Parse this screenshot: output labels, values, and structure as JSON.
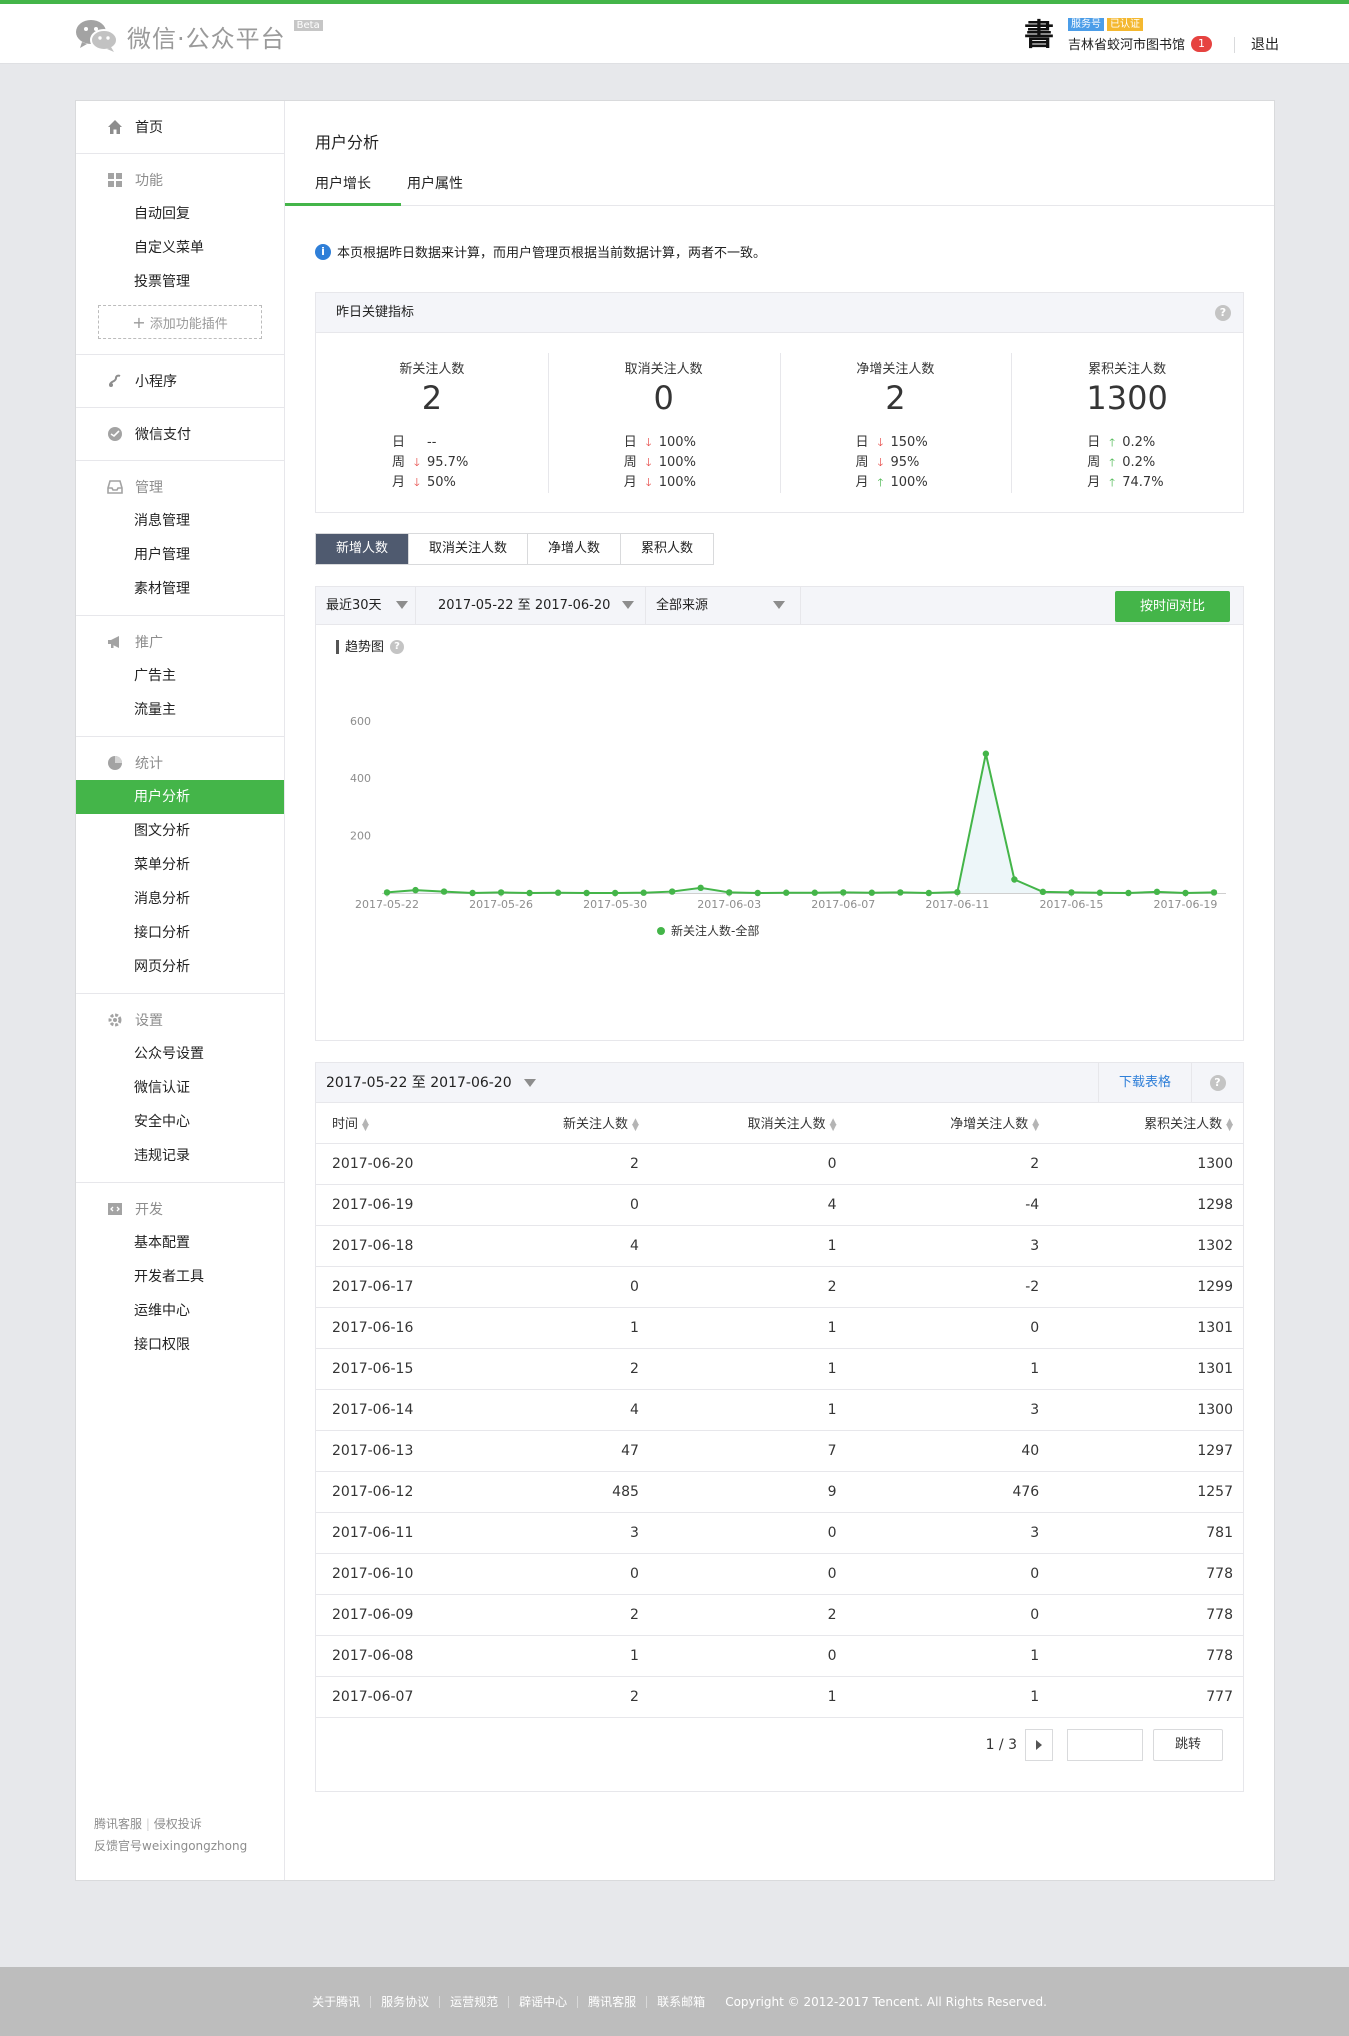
{
  "brand": {
    "name": "微信·公众平台",
    "beta": "Beta"
  },
  "account": {
    "type_badge": "服务号",
    "verified_badge": "已认证",
    "name": "吉林省蛟河市图书馆",
    "msg_count": "1",
    "logout": "退出",
    "avatar_glyph": "書"
  },
  "sidebar": {
    "home": "首页",
    "func_title": "功能",
    "func_items": [
      "自动回复",
      "自定义菜单",
      "投票管理"
    ],
    "add_plugin": "添加功能插件",
    "miniprogram": "小程序",
    "wxpay": "微信支付",
    "manage_title": "管理",
    "manage_items": [
      "消息管理",
      "用户管理",
      "素材管理"
    ],
    "promo_title": "推广",
    "promo_items": [
      "广告主",
      "流量主"
    ],
    "stats_title": "统计",
    "stats_items": [
      "用户分析",
      "图文分析",
      "菜单分析",
      "消息分析",
      "接口分析",
      "网页分析"
    ],
    "settings_title": "设置",
    "settings_items": [
      "公众号设置",
      "微信认证",
      "安全中心",
      "违规记录"
    ],
    "dev_title": "开发",
    "dev_items": [
      "基本配置",
      "开发者工具",
      "运维中心",
      "接口权限"
    ],
    "footer_links": [
      "腾讯客服",
      "侵权投诉"
    ],
    "footer_feedback": "反馈官号weixingongzhong"
  },
  "page": {
    "title": "用户分析",
    "tabs": [
      "用户增长",
      "用户属性"
    ],
    "notice": "本页根据昨日数据来计算，而用户管理页根据当前数据计算，两者不一致。"
  },
  "kpi": {
    "title": "昨日关键指标",
    "row_labels": [
      "日",
      "周",
      "月"
    ],
    "cards": [
      {
        "label": "新关注人数",
        "value": "2",
        "rows": [
          {
            "dir": "none",
            "val": "--"
          },
          {
            "dir": "down",
            "val": "95.7%"
          },
          {
            "dir": "down",
            "val": "50%"
          }
        ]
      },
      {
        "label": "取消关注人数",
        "value": "0",
        "rows": [
          {
            "dir": "down",
            "val": "100%"
          },
          {
            "dir": "down",
            "val": "100%"
          },
          {
            "dir": "down",
            "val": "100%"
          }
        ]
      },
      {
        "label": "净增关注人数",
        "value": "2",
        "rows": [
          {
            "dir": "down",
            "val": "150%"
          },
          {
            "dir": "down",
            "val": "95%"
          },
          {
            "dir": "up",
            "val": "100%"
          }
        ]
      },
      {
        "label": "累积关注人数",
        "value": "1300",
        "rows": [
          {
            "dir": "up",
            "val": "0.2%"
          },
          {
            "dir": "up",
            "val": "0.2%"
          },
          {
            "dir": "up",
            "val": "74.7%"
          }
        ]
      }
    ]
  },
  "metric_tabs": [
    "新增人数",
    "取消关注人数",
    "净增人数",
    "累积人数"
  ],
  "filters": {
    "period": "最近30天",
    "range": "2017-05-22 至 2017-06-20",
    "source": "全部来源",
    "compare_btn": "按时间对比"
  },
  "chart_title": "趋势图",
  "chart_data": {
    "type": "line",
    "title": "趋势图",
    "x": [
      "2017-05-22",
      "2017-05-23",
      "2017-05-24",
      "2017-05-25",
      "2017-05-26",
      "2017-05-27",
      "2017-05-28",
      "2017-05-29",
      "2017-05-30",
      "2017-05-31",
      "2017-06-01",
      "2017-06-02",
      "2017-06-03",
      "2017-06-04",
      "2017-06-05",
      "2017-06-06",
      "2017-06-07",
      "2017-06-08",
      "2017-06-09",
      "2017-06-10",
      "2017-06-11",
      "2017-06-12",
      "2017-06-13",
      "2017-06-14",
      "2017-06-15",
      "2017-06-16",
      "2017-06-17",
      "2017-06-18",
      "2017-06-19",
      "2017-06-20"
    ],
    "x_ticks": [
      "2017-05-22",
      "2017-05-26",
      "2017-05-30",
      "2017-06-03",
      "2017-06-07",
      "2017-06-11",
      "2017-06-15",
      "2017-06-19"
    ],
    "series": [
      {
        "name": "新关注人数-全部",
        "color": "#44b549",
        "values": [
          2,
          10,
          5,
          0,
          2,
          0,
          1,
          0,
          0,
          1,
          5,
          18,
          2,
          0,
          1,
          1,
          2,
          1,
          2,
          0,
          3,
          485,
          47,
          4,
          2,
          1,
          0,
          4,
          0,
          2
        ]
      }
    ],
    "ylim": [
      0,
      600
    ],
    "yticks": [
      200,
      400,
      600
    ],
    "grid": false,
    "legend": "bottom-center"
  },
  "table": {
    "range": "2017-05-22 至 2017-06-20",
    "download": "下载表格",
    "headers": [
      "时间",
      "新关注人数",
      "取消关注人数",
      "净增关注人数",
      "累积关注人数"
    ],
    "rows": [
      [
        "2017-06-20",
        "2",
        "0",
        "2",
        "1300"
      ],
      [
        "2017-06-19",
        "0",
        "4",
        "-4",
        "1298"
      ],
      [
        "2017-06-18",
        "4",
        "1",
        "3",
        "1302"
      ],
      [
        "2017-06-17",
        "0",
        "2",
        "-2",
        "1299"
      ],
      [
        "2017-06-16",
        "1",
        "1",
        "0",
        "1301"
      ],
      [
        "2017-06-15",
        "2",
        "1",
        "1",
        "1301"
      ],
      [
        "2017-06-14",
        "4",
        "1",
        "3",
        "1300"
      ],
      [
        "2017-06-13",
        "47",
        "7",
        "40",
        "1297"
      ],
      [
        "2017-06-12",
        "485",
        "9",
        "476",
        "1257"
      ],
      [
        "2017-06-11",
        "3",
        "0",
        "3",
        "781"
      ],
      [
        "2017-06-10",
        "0",
        "0",
        "0",
        "778"
      ],
      [
        "2017-06-09",
        "2",
        "2",
        "0",
        "778"
      ],
      [
        "2017-06-08",
        "1",
        "0",
        "1",
        "778"
      ],
      [
        "2017-06-07",
        "2",
        "1",
        "1",
        "777"
      ]
    ],
    "page": "1 / 3",
    "go": "跳转"
  },
  "footer": {
    "links": [
      "关于腾讯",
      "服务协议",
      "运营规范",
      "辟谣中心",
      "腾讯客服",
      "联系邮箱"
    ],
    "copyright": "Copyright © 2012-2017 Tencent. All Rights Reserved."
  }
}
